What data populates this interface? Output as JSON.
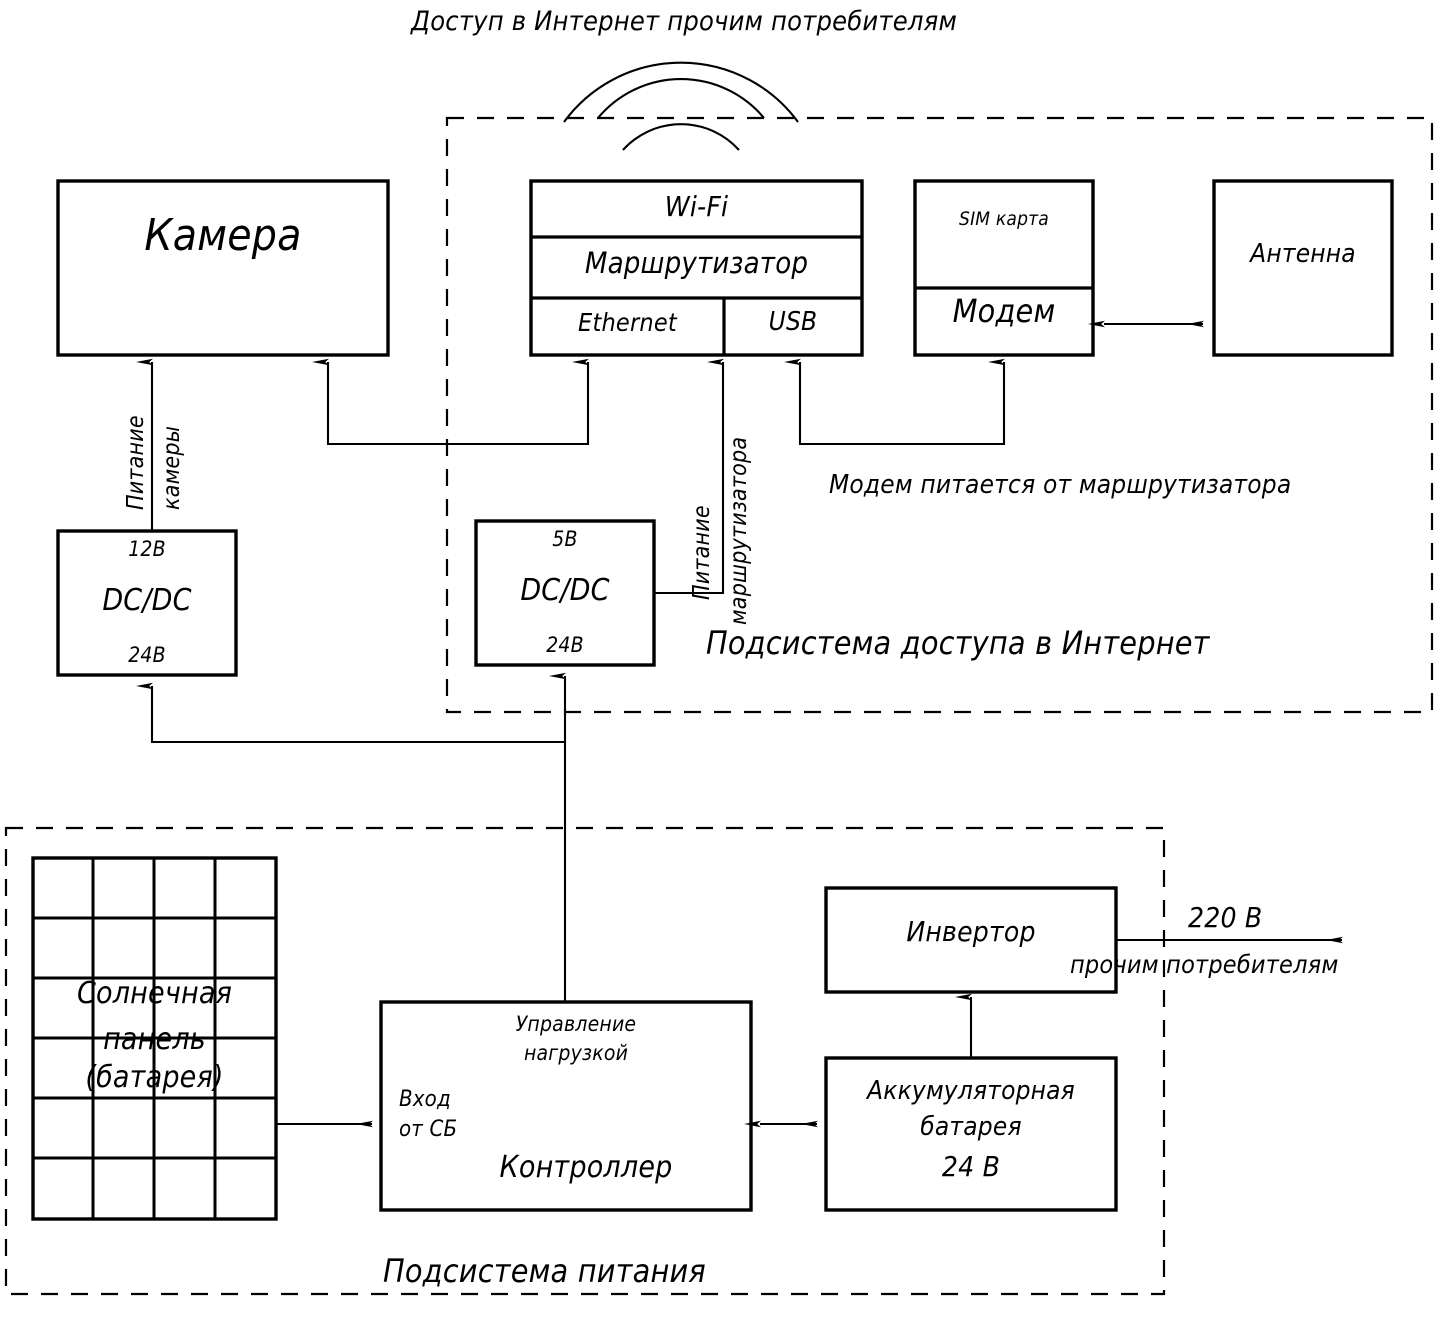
{
  "diagram": {
    "title": "Доступ в Интернет прочим потребителям",
    "subsystems": {
      "internet": "Подсистема доступа в Интернет",
      "power": "Подсистема питания"
    },
    "blocks": {
      "camera": "Камера",
      "router_wifi": "Wi-Fi",
      "router_main": "Маршрутизатор",
      "router_ethernet": "Ethernet",
      "router_usb": "USB",
      "modem_sim": "SIM карта",
      "modem": "Модем",
      "antenna": "Антенна",
      "dcdc_camera_out": "12В",
      "dcdc_camera_name": "DC/DC",
      "dcdc_camera_in": "24В",
      "dcdc_router_out": "5В",
      "dcdc_router_name": "DC/DC",
      "dcdc_router_in": "24В",
      "solar_line1": "Солнечная",
      "solar_line2": "панель",
      "solar_line3": "(батарея)",
      "controller_top1": "Управление",
      "controller_top2": "нагрузкой",
      "controller_left1": "Вход",
      "controller_left2": "от СБ",
      "controller_name": "Контроллер",
      "inverter": "Инвертор",
      "battery_line1": "Аккумуляторная",
      "battery_line2": "батарея",
      "battery_line3": "24 В"
    },
    "labels": {
      "power_camera_1": "Питание",
      "power_camera_2": "камеры",
      "power_router_1": "Питание",
      "power_router_2": "маршрутизатора",
      "modem_note": "Модем питается от маршрутизатора",
      "output_voltage": "220 В",
      "output_consumers": "прочим потребителям"
    },
    "icons": {
      "wifi_waves": "wifi-signal-icon",
      "solar_grid": "solar-panel-grid-icon"
    },
    "colors": {
      "stroke": "#000000",
      "background": "#ffffff"
    }
  }
}
